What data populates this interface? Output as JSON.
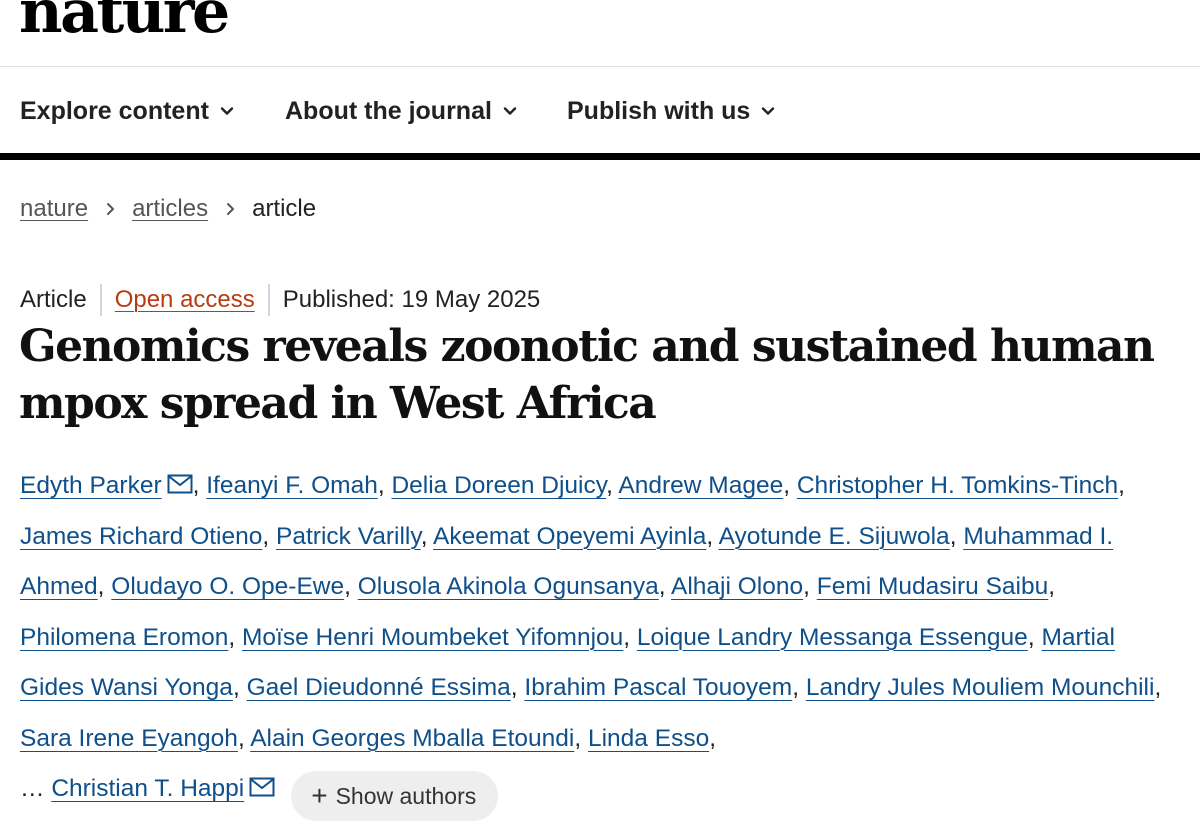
{
  "header": {
    "logo": "nature"
  },
  "nav": {
    "items": [
      {
        "label": "Explore content"
      },
      {
        "label": "About the journal"
      },
      {
        "label": "Publish with us"
      }
    ]
  },
  "breadcrumb": {
    "items": [
      {
        "label": "nature"
      },
      {
        "label": "articles"
      },
      {
        "label": "article"
      }
    ]
  },
  "article": {
    "type": "Article",
    "access": "Open access",
    "published": "Published: 19 May 2025",
    "title": "Genomics reveals zoonotic and sustained human mpox spread in West Africa",
    "authors": [
      "Edyth Parker",
      "Ifeanyi F. Omah",
      "Delia Doreen Djuicy",
      "Andrew Magee",
      "Christopher H. Tomkins-Tinch",
      "James Richard Otieno",
      "Patrick Varilly",
      "Akeemat Opeyemi Ayinla",
      "Ayotunde E. Sijuwola",
      "Muhammad I. Ahmed",
      "Oludayo O. Ope-Ewe",
      "Olusola Akinola Ogunsanya",
      "Alhaji Olono",
      "Femi Mudasiru Saibu",
      "Philomena Eromon",
      "Moïse Henri Moumbeket Yifomnjou",
      "Loique Landry Messanga Essengue",
      "Martial Gides Wansi Yonga",
      "Gael Dieudonné Essima",
      "Ibrahim Pascal Touoyem",
      "Landry Jules Mouliem Mounchili",
      "Sara Irene Eyangoh",
      "Alain Georges Mballa Etoundi",
      "Linda Esso"
    ],
    "ellipsis": "…",
    "last_author": "Christian T. Happi",
    "show_authors_label": "Show authors"
  },
  "icons": {
    "nav_chevron": "chevron-down-icon",
    "breadcrumb_separator": "chevron-right-icon",
    "mail": "mail-icon",
    "plus": "plus-icon"
  },
  "colors": {
    "link": "#0f4f8a",
    "open_access": "#b83c12",
    "nav_border": "#000000",
    "button_bg": "#eeeeee"
  }
}
